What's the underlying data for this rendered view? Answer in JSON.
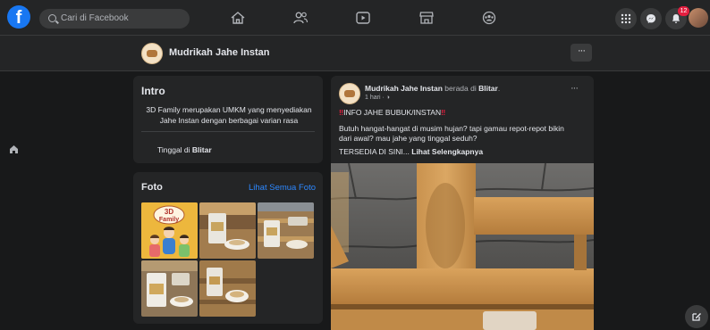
{
  "topbar": {
    "search_placeholder": "Cari di Facebook",
    "notification_count": "12",
    "nav_icons": [
      "home-icon",
      "friends-icon",
      "watch-icon",
      "marketplace-icon",
      "groups-icon"
    ],
    "right_icons": [
      "menu-grid-icon",
      "messenger-icon",
      "notifications-icon"
    ]
  },
  "page_header": {
    "name": "Mudrikah Jahe Instan",
    "more_label": "···"
  },
  "intro": {
    "title": "Intro",
    "description": "3D Family merupakan UMKM yang menyediakan Jahe Instan dengan berbagai varian rasa",
    "lives_prefix": "Tinggal di ",
    "lives_place": "Blitar"
  },
  "photos": {
    "title": "Foto",
    "see_all": "Lihat Semua Foto",
    "logo_text_1": "3D",
    "logo_text_2": "Family"
  },
  "post": {
    "author": "Mudrikah Jahe Instan",
    "location_prefix": " berada di ",
    "location": "Blitar",
    "location_suffix": ".",
    "time": "1 hari · ",
    "more_label": "···",
    "marks": "‼",
    "heading": "INFO JAHE BUBUK/INSTAN",
    "body_line_1": "Butuh hangat-hangat di musim hujan? tapi gamau repot-repot bikin",
    "body_line_2": "dari awal? mau jahe yang tinggal seduh?",
    "body_line_3": "TERSEDIA DI SINI... ",
    "see_more": "Lihat Selengkapnya"
  },
  "colors": {
    "background": "#18191a",
    "surface": "#242526",
    "accent": "#2d88ff",
    "brand": "#1877f2",
    "alert": "#e41e3f"
  }
}
